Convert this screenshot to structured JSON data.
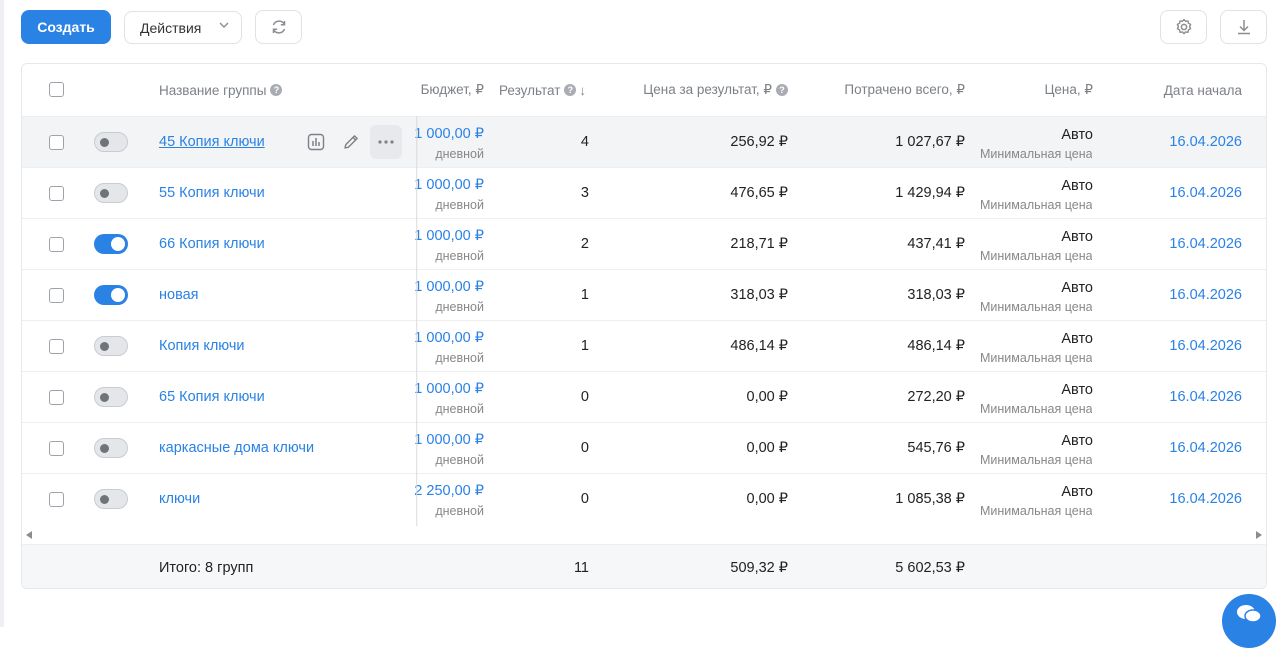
{
  "toolbar": {
    "create_label": "Создать",
    "actions_label": "Действия"
  },
  "table": {
    "headers": {
      "name": "Название группы",
      "budget": "Бюджет, ₽",
      "result": "Результат",
      "sort_arrow": "↓",
      "cost_per_result": "Цена за результат, ₽",
      "spent_total": "Потрачено всего, ₽",
      "price": "Цена, ₽",
      "start_date": "Дата начала"
    },
    "rows": [
      {
        "enabled": false,
        "name": "45 Копия ключи",
        "budget": "1 000,00 ₽",
        "budget_type": "дневной",
        "result": "4",
        "cost_per_result": "256,92 ₽",
        "spent": "1 027,67 ₽",
        "price": "Авто",
        "price_sub": "Минимальная цена",
        "date": "16.04.2026"
      },
      {
        "enabled": false,
        "name": "55 Копия ключи",
        "budget": "1 000,00 ₽",
        "budget_type": "дневной",
        "result": "3",
        "cost_per_result": "476,65 ₽",
        "spent": "1 429,94 ₽",
        "price": "Авто",
        "price_sub": "Минимальная цена",
        "date": "16.04.2026"
      },
      {
        "enabled": true,
        "name": "66 Копия ключи",
        "budget": "1 000,00 ₽",
        "budget_type": "дневной",
        "result": "2",
        "cost_per_result": "218,71 ₽",
        "spent": "437,41 ₽",
        "price": "Авто",
        "price_sub": "Минимальная цена",
        "date": "16.04.2026"
      },
      {
        "enabled": true,
        "name": "новая",
        "budget": "1 000,00 ₽",
        "budget_type": "дневной",
        "result": "1",
        "cost_per_result": "318,03 ₽",
        "spent": "318,03 ₽",
        "price": "Авто",
        "price_sub": "Минимальная цена",
        "date": "16.04.2026"
      },
      {
        "enabled": false,
        "name": "Копия ключи",
        "budget": "1 000,00 ₽",
        "budget_type": "дневной",
        "result": "1",
        "cost_per_result": "486,14 ₽",
        "spent": "486,14 ₽",
        "price": "Авто",
        "price_sub": "Минимальная цена",
        "date": "16.04.2026"
      },
      {
        "enabled": false,
        "name": "65 Копия ключи",
        "budget": "1 000,00 ₽",
        "budget_type": "дневной",
        "result": "0",
        "cost_per_result": "0,00 ₽",
        "spent": "272,20 ₽",
        "price": "Авто",
        "price_sub": "Минимальная цена",
        "date": "16.04.2026"
      },
      {
        "enabled": false,
        "name": "каркасные дома ключи",
        "budget": "1 000,00 ₽",
        "budget_type": "дневной",
        "result": "0",
        "cost_per_result": "0,00 ₽",
        "spent": "545,76 ₽",
        "price": "Авто",
        "price_sub": "Минимальная цена",
        "date": "16.04.2026"
      },
      {
        "enabled": false,
        "name": "ключи",
        "budget": "2 250,00 ₽",
        "budget_type": "дневной",
        "result": "0",
        "cost_per_result": "0,00 ₽",
        "spent": "1 085,38 ₽",
        "price": "Авто",
        "price_sub": "Минимальная цена",
        "date": "16.04.2026"
      }
    ],
    "footer": {
      "total_label": "Итого: 8 групп",
      "result": "11",
      "cost_per_result": "509,32 ₽",
      "spent": "5 602,53 ₽"
    }
  },
  "colors": {
    "accent": "#2a82e4",
    "row_highlight": "#f3f4f6"
  },
  "icons": [
    "refresh-icon",
    "gear-icon",
    "download-icon",
    "chart-icon",
    "pencil-icon",
    "more-icon",
    "chat-icon",
    "help-icon"
  ]
}
